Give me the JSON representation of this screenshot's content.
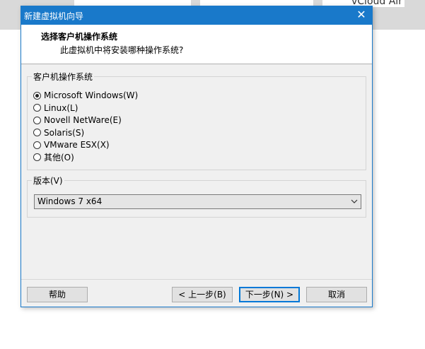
{
  "background": {
    "app_text": "vCloud Air"
  },
  "dialog": {
    "title": "新建虚拟机向导",
    "close_glyph": "✕",
    "header": {
      "title": "选择客户机操作系统",
      "subtitle": "此虚拟机中将安装哪种操作系统?"
    },
    "os_group": {
      "legend": "客户机操作系统",
      "options": [
        {
          "label": "Microsoft Windows(W)",
          "checked": true
        },
        {
          "label": "Linux(L)",
          "checked": false
        },
        {
          "label": "Novell NetWare(E)",
          "checked": false
        },
        {
          "label": "Solaris(S)",
          "checked": false
        },
        {
          "label": "VMware ESX(X)",
          "checked": false
        },
        {
          "label": "其他(O)",
          "checked": false
        }
      ]
    },
    "version_group": {
      "legend": "版本(V)",
      "selected": "Windows 7 x64"
    },
    "buttons": {
      "help": "帮助",
      "back": "< 上一步(B)",
      "next": "下一步(N) >",
      "cancel": "取消"
    }
  },
  "colors": {
    "titlebar": "#1979ca",
    "dialog_bg": "#f0f0f0",
    "primary_border": "#0078d7"
  }
}
